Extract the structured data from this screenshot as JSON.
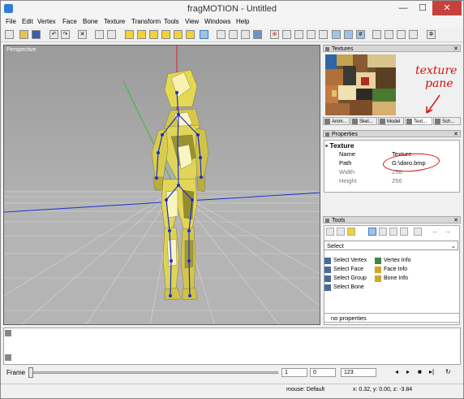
{
  "window": {
    "title": "fragMOTION - Untitled",
    "min": "—",
    "max": "☐",
    "close": "✕"
  },
  "menu": [
    "File",
    "Edit",
    "Vertex",
    "Face",
    "Bone",
    "Texture",
    "Transform",
    "Tools",
    "View",
    "Windows",
    "Help"
  ],
  "viewport": {
    "label": "Perspective"
  },
  "textures_panel": {
    "title": "Textures",
    "tabs": [
      "Anim...",
      "Skel...",
      "Model",
      "Text...",
      "Sch..."
    ]
  },
  "annotation": {
    "line1": "texture",
    "line2": "pane"
  },
  "properties": {
    "title": "Properties",
    "section": "Texture",
    "rows": [
      {
        "key": "Name",
        "value": "Texture"
      },
      {
        "key": "Path",
        "value": "G:\\daro.bmp"
      },
      {
        "key": "Width",
        "value": "256"
      },
      {
        "key": "Height",
        "value": "256"
      }
    ]
  },
  "tools": {
    "title": "Tools",
    "select_value": "Select",
    "items_left": [
      "Select Vertex",
      "Select Face",
      "Select Group",
      "Select Bone"
    ],
    "items_right": [
      "Vertex Info",
      "Face Info",
      "Bone Info"
    ],
    "no_properties": "no properties"
  },
  "framebar": {
    "label": "Frame",
    "start": "1",
    "current": "0",
    "end": "123"
  },
  "status": {
    "mouse": "mouse: Default",
    "coords": "x: 0.32, y: 0.00, z: -3.84"
  }
}
